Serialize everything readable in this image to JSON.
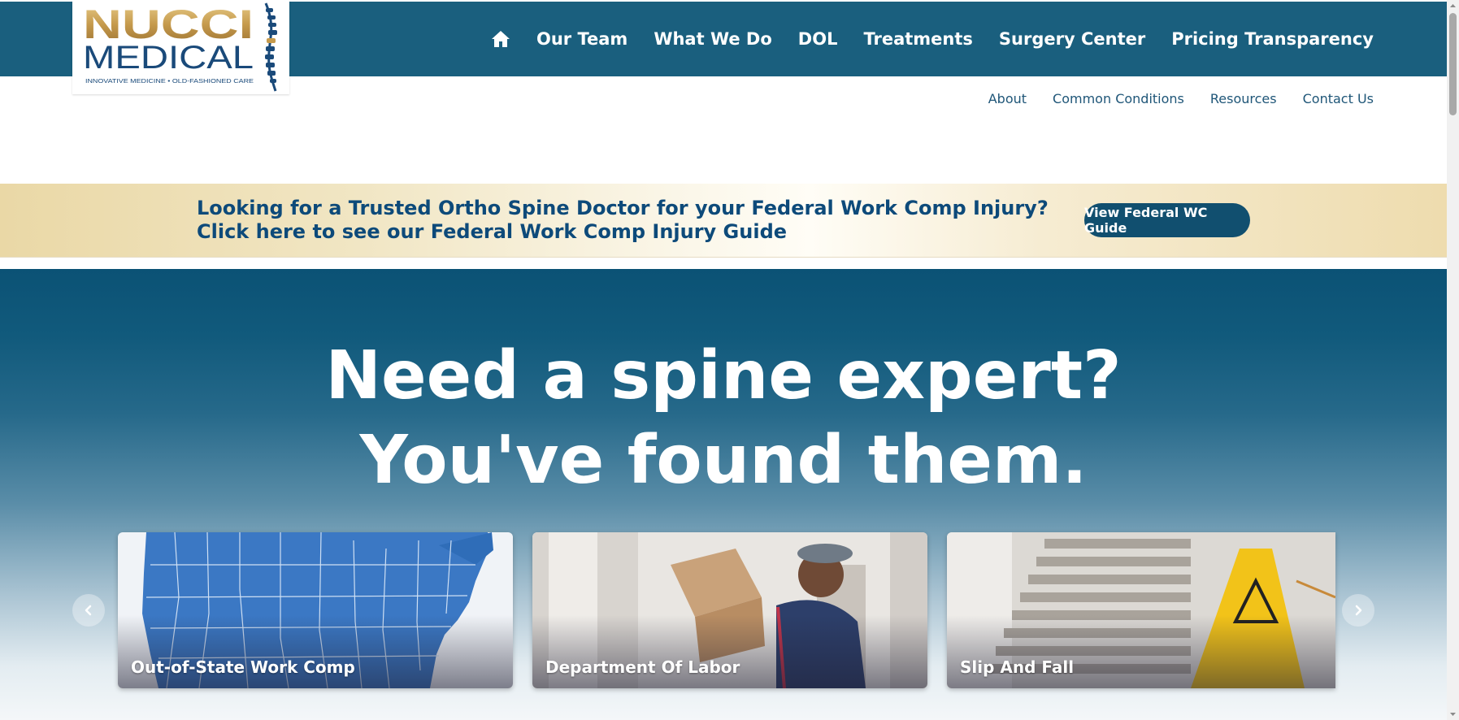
{
  "logo": {
    "line1": "NUCCI",
    "line2": "MEDICAL",
    "tagline": "INNOVATIVE MEDICINE • OLD-FASHIONED CARE"
  },
  "main_nav": [
    "Our Team",
    "What We Do",
    "DOL",
    "Treatments",
    "Surgery Center",
    "Pricing Transparency"
  ],
  "sub_nav": [
    "About",
    "Common Conditions",
    "Resources",
    "Contact Us"
  ],
  "banner": {
    "text": "Looking for a Trusted Ortho Spine Doctor for your Federal Work Comp Injury? Click here to see our Federal Work Comp Injury Guide",
    "button": "View Federal WC Guide"
  },
  "hero": {
    "line1": "Need a spine expert?",
    "line2": "You've found them."
  },
  "cards": [
    "Out-of-State Work Comp",
    "Department Of Labor",
    "Slip And Fall"
  ],
  "icons": {
    "home": "home-icon",
    "prev": "chevron-left-icon",
    "next": "chevron-right-icon"
  },
  "colors": {
    "header": "#1a5f7e",
    "button": "#114f6f",
    "banner_text": "#0d4a7a",
    "gold": "#c59a4c"
  }
}
